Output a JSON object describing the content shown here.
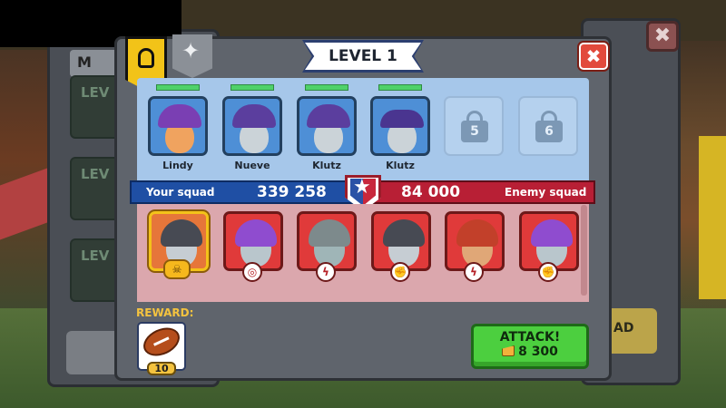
{
  "level_title": "LEVEL 1",
  "close_glyph": "✖",
  "under_close_glyph": "✖",
  "squad": {
    "label": "Your squad",
    "power": "339 258",
    "heroes": [
      {
        "name": "Lindy",
        "hp_fraction": 1.0
      },
      {
        "name": "Nueve",
        "hp_fraction": 1.0
      },
      {
        "name": "Klutz",
        "hp_fraction": 1.0
      },
      {
        "name": "Klutz",
        "hp_fraction": 1.0
      }
    ],
    "locked_slots": [
      {
        "unlock_level": "5"
      },
      {
        "unlock_level": "6"
      }
    ]
  },
  "enemy": {
    "label": "Enemy squad",
    "power": "84 000",
    "units": [
      {
        "type": "football-player",
        "role_icon": "skull-icon",
        "role_glyph": "☠"
      },
      {
        "type": "alien",
        "role_icon": "target-icon",
        "role_glyph": "◎"
      },
      {
        "type": "alien-mage",
        "role_icon": "lightning-icon",
        "role_glyph": "ϟ"
      },
      {
        "type": "football-player",
        "role_icon": "fist-icon",
        "role_glyph": "✊"
      },
      {
        "type": "bearded-man",
        "role_icon": "lightning-icon",
        "role_glyph": "ϟ"
      },
      {
        "type": "alien",
        "role_icon": "fist-icon",
        "role_glyph": "✊"
      }
    ]
  },
  "reward": {
    "label": "REWARD:",
    "item_icon": "football-icon",
    "count": "10"
  },
  "attack": {
    "label": "ATTACK!",
    "cost": "8 300",
    "cost_icon": "pie-icon"
  },
  "background": {
    "left_panel_tab": "M",
    "left_cards": [
      "LEV",
      "LEV",
      "LEV"
    ],
    "right_button": "AD"
  },
  "colors": {
    "your_squad_bar": "#1f4fa4",
    "enemy_squad_bar": "#b81f35",
    "attack_button": "#4ccf3f",
    "close_button": "#e24a3c",
    "squad_tab": "#f2c318"
  }
}
